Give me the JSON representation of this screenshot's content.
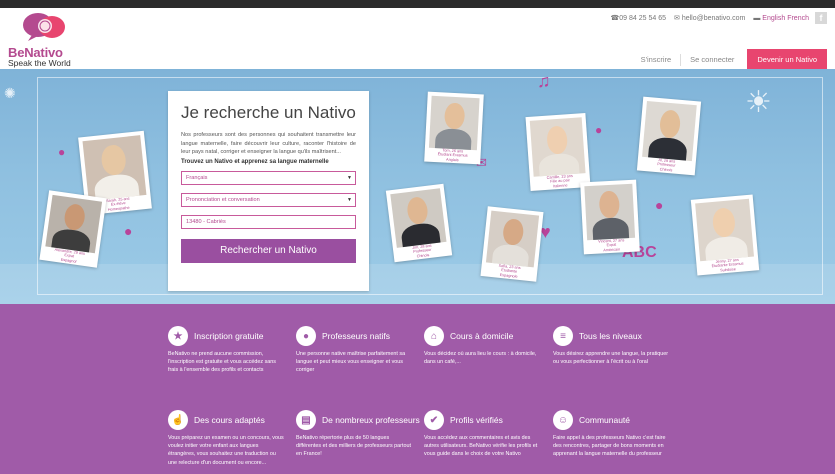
{
  "header": {
    "logo_name": "BeNativo",
    "logo_tagline": "Speak the World",
    "phone": "09 84 25 54 65",
    "email": "hello@benativo.com",
    "language": "English French",
    "facebook_label": "f",
    "nav": {
      "signup": "S'inscrire",
      "login": "Se connecter",
      "become_nativo": "Devenir un Nativo"
    },
    "colors": {
      "brand": "#b44a8f",
      "cta": "#e8456f"
    }
  },
  "search": {
    "title": "Je recherche un Nativo",
    "description": "Nos professeurs sont des personnes qui souhaitent transmettre leur langue maternelle, faire découvrir leur culture, raconter l'histoire de leur pays natal, corriger et enseigner la langue qu'ils maîtrisent...",
    "subtitle": "Trouvez un Nativo et apprenez sa langue maternelle",
    "language_value": "Français",
    "course_value": "Prononciation et conversation",
    "location_value": "13480 - Cabriès",
    "button": "Rechercher un Nativo"
  },
  "profiles": [
    {
      "caption": "Sarah, 25 ans\nEx-élève\nHomeopathe"
    },
    {
      "caption": "Alexandre, 29 ans\nExpat\nEspagnol"
    },
    {
      "caption": "Tom, 26 ans\nÉtudiant Erasmus\nAnglais"
    },
    {
      "caption": "Camille, 23 ans\nFille au pair\nItalienne"
    },
    {
      "caption": "Al, 29 ans\nProfesseur\nChinois"
    },
    {
      "caption": "Jim, 28 ans\nProfesseur\nChinois"
    },
    {
      "caption": "Sofia, 23 ans\nÉtudiante\nEspagnole"
    },
    {
      "caption": "Vincent, 27 ans\nExpat\nAméricain"
    },
    {
      "caption": "Jenny, 27 ans\nÉtudiante Erasmus\nSuédoise"
    }
  ],
  "features": [
    {
      "icon": "star-icon",
      "glyph": "★",
      "title": "Inscription gratuite",
      "text": "BeNativo ne prend aucune commission, l'inscription est gratuite et vous accédez sans frais à l'ensemble des profils et contacts"
    },
    {
      "icon": "globe-icon",
      "glyph": "●",
      "title": "Professeurs natifs",
      "text": "Une personne native maîtrise parfaitement sa langue et peut mieux vous enseigner et vous corriger"
    },
    {
      "icon": "home-icon",
      "glyph": "⌂",
      "title": "Cours à domicile",
      "text": "Vous décidez où aura lieu le cours : à domicile, dans un café,..."
    },
    {
      "icon": "levels-icon",
      "glyph": "≡",
      "title": "Tous les niveaux",
      "text": "Vous désirez apprendre une langue, la pratiquer ou vous perfectionner à l'écrit ou à l'oral"
    },
    {
      "icon": "thumbs-up-icon",
      "glyph": "☝",
      "title": "Des cours adaptés",
      "text": "Vous préparez un examen ou un concours, vous voulez initier votre enfant aux langues étrangères, vous souhaitez une traduction ou une relecture d'un document ou encore..."
    },
    {
      "icon": "book-icon",
      "glyph": "▤",
      "title": "De nombreux professeurs",
      "text": "BeNativo répertorie plus de 50 langues différentes et des milliers de professeurs partout en France!"
    },
    {
      "icon": "check-icon",
      "glyph": "✔",
      "title": "Profils vérifiés",
      "text": "Vous accédez aux commentaires et avis des autres utilisateurs. BeNativo vérifie les profils et vous guide dans le choix de votre Nativo"
    },
    {
      "icon": "community-icon",
      "glyph": "☺",
      "title": "Communauté",
      "text": "Faire appel à des professeurs Nativo c'est faire des rencontres, partager de bons moments en apprenant la langue maternelle du professeur"
    }
  ]
}
